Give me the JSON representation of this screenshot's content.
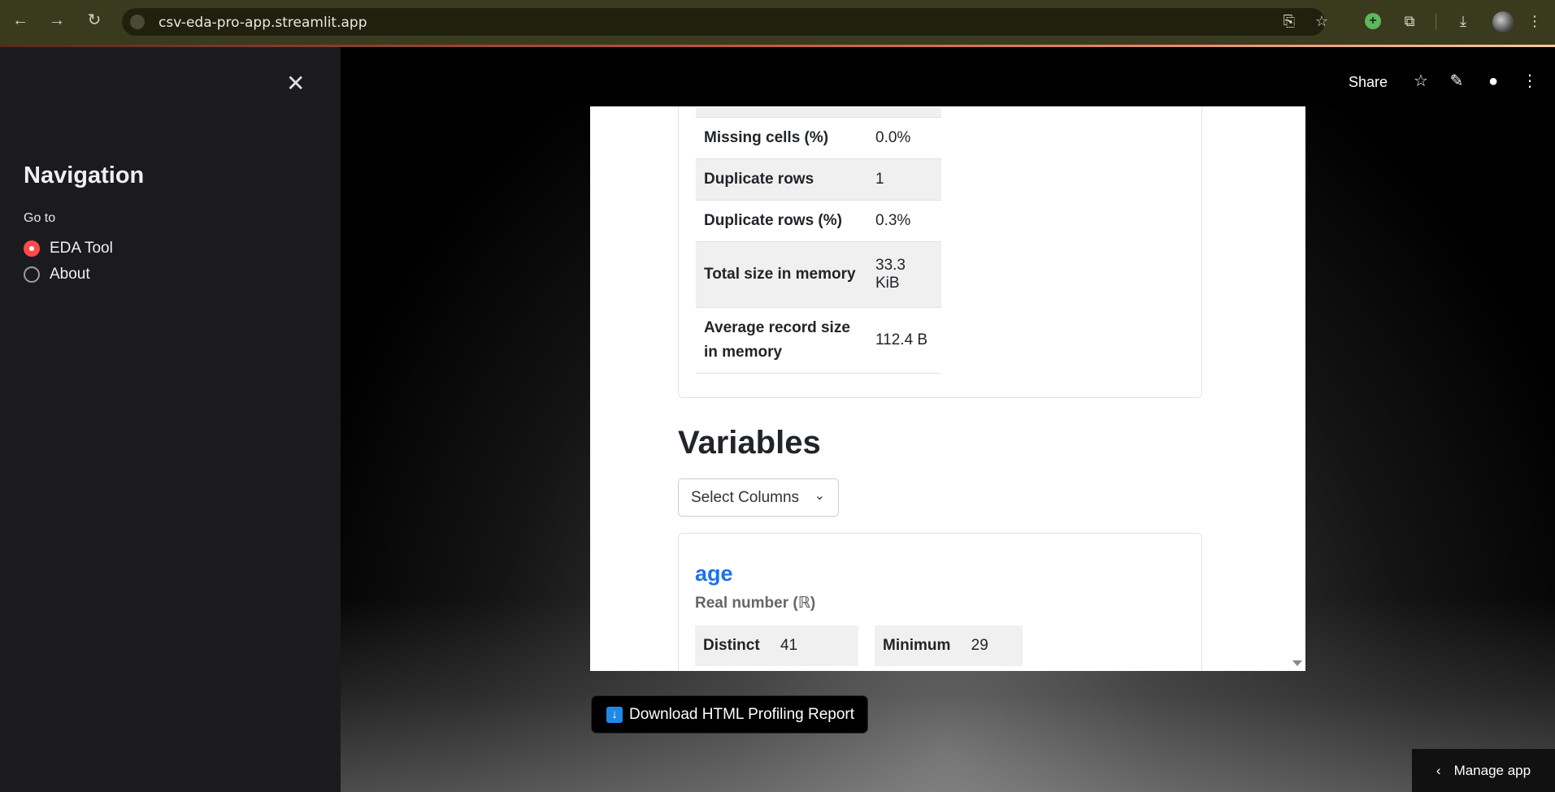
{
  "browser": {
    "url": "csv-eda-pro-app.streamlit.app"
  },
  "sidebar": {
    "title": "Navigation",
    "goto_label": "Go to",
    "options": [
      {
        "label": "EDA Tool",
        "selected": true
      },
      {
        "label": "About",
        "selected": false
      }
    ]
  },
  "header": {
    "share_label": "Share"
  },
  "report": {
    "overview_rows": [
      {
        "key": "Missing cells (%)",
        "value": "0.0%"
      },
      {
        "key": "Duplicate rows",
        "value": "1"
      },
      {
        "key": "Duplicate rows (%)",
        "value": "0.3%"
      },
      {
        "key": "Total size in memory",
        "value": "33.3 KiB"
      },
      {
        "key": "Average record size in memory",
        "value": "112.4 B"
      }
    ],
    "variables_heading": "Variables",
    "select_columns_label": "Select Columns",
    "variable": {
      "name": "age",
      "type": "Real number (ℝ)",
      "distinct_label": "Distinct",
      "distinct_value": "41",
      "minimum_label": "Minimum",
      "minimum_value": "29"
    }
  },
  "download_button_label": "Download HTML Profiling Report",
  "manage_app_label": "Manage app",
  "colors": {
    "accent": "#ff4b4b",
    "link": "#1a73e8"
  }
}
